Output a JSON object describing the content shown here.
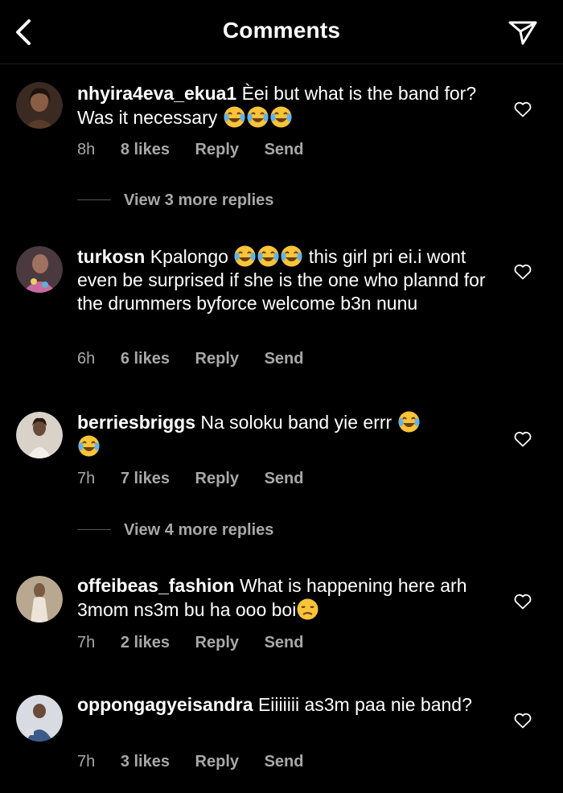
{
  "header": {
    "title": "Comments"
  },
  "comments": [
    {
      "username": "nhyira4eva_ekua1",
      "text_parts": [
        "Èei but what is the band for? Was it necessary ",
        "",
        "",
        ""
      ],
      "time": "8h",
      "likes": "8 likes",
      "reply": "Reply",
      "send": "Send",
      "avatar_color": "#6b4a3a"
    },
    {
      "username": "turkosn",
      "text_parts": [
        "Kpalongo ",
        "this girl pri ei.i wont even be surprised if she is the one who plannd for the drummers byforce welcome b3n nunu"
      ],
      "time": "6h",
      "likes": "6 likes",
      "reply": "Reply",
      "send": "Send",
      "avatar_color": "#8a5a7a"
    },
    {
      "username": "berriesbriggs",
      "text_parts": [
        "Na soloku band yie errr "
      ],
      "time": "7h",
      "likes": "7 likes",
      "reply": "Reply",
      "send": "Send",
      "avatar_color": "#7a6a5a"
    },
    {
      "username": "offeibeas_fashion",
      "text_parts": [
        "What is happening here arh 3mom ns3m bu ha ooo boi"
      ],
      "time": "7h",
      "likes": "2 likes",
      "reply": "Reply",
      "send": "Send",
      "avatar_color": "#9a8a70"
    },
    {
      "username": "oppongagyeisandra",
      "text_parts": [
        "Eiiiiiii as3m paa nie band?"
      ],
      "time": "7h",
      "likes": "3 likes",
      "reply": "Reply",
      "send": "Send",
      "avatar_color": "#5a6a80"
    }
  ],
  "view_more": [
    {
      "label": "View 3 more replies"
    },
    {
      "label": "View 4 more replies"
    }
  ],
  "icons": {
    "back": "chevron-left-icon",
    "send": "paper-plane-icon",
    "like": "heart-outline-icon",
    "laugh": "face-with-tears-of-joy-emoji",
    "sad": "disappointed-face-emoji"
  },
  "colors": {
    "background": "#000000",
    "text": "#ffffff",
    "muted": "#a8a8a8"
  }
}
